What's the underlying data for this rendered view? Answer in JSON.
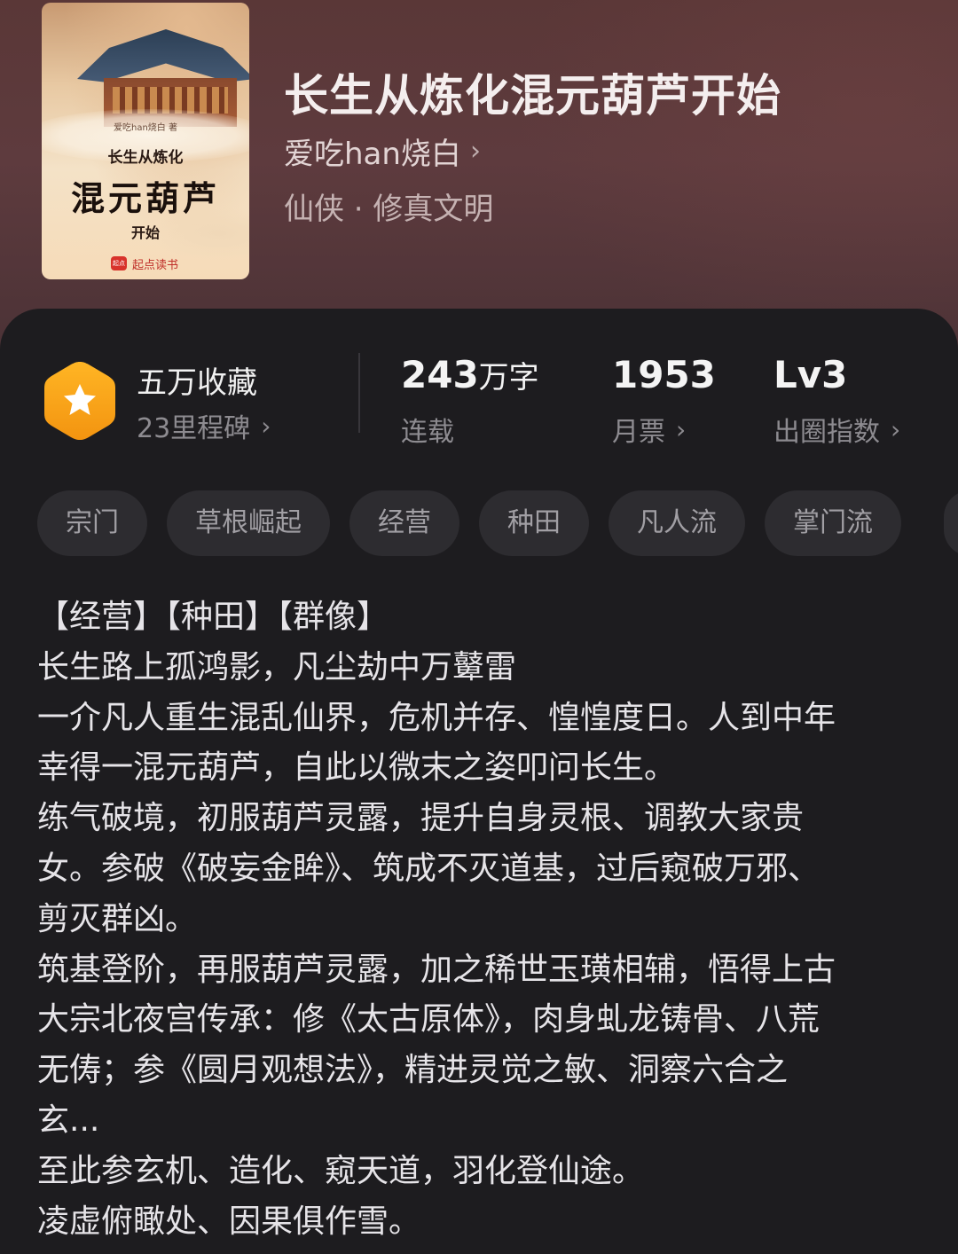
{
  "book": {
    "title": "长生从炼化混元葫芦开始",
    "author": "爱吃han烧白",
    "genre": "仙侠 · 修真文明",
    "cover": {
      "author_line": "爱吃han烧白 著",
      "title_top": "长生从炼化",
      "title_main": "混元葫芦",
      "title_bottom": "开始",
      "publisher": "起点读书",
      "publisher_logo": "起点"
    }
  },
  "stats": {
    "collect_label": "五万收藏",
    "milestone_label": "23里程碑",
    "words_value": "243",
    "words_unit": "万字",
    "words_status": "连载",
    "monthly_value": "1953",
    "monthly_label": "月票",
    "index_value": "Lv3",
    "index_label": "出圈指数"
  },
  "tags": [
    "宗门",
    "草根崛起",
    "经营",
    "种田",
    "凡人流",
    "掌门流"
  ],
  "synopsis": [
    "【经营】【种田】【群像】",
    "长生路上孤鸿影，凡尘劫中万鼙雷",
    "一介凡人重生混乱仙界，危机并存、惶惶度日。人到中年",
    "幸得一混元葫芦，自此以微末之姿叩问长生。",
    "练气破境，初服葫芦灵露，提升自身灵根、调教大家贵",
    "女。参破《破妄金眸》、筑成不灭道基，过后窥破万邪、",
    "剪灭群凶。",
    "筑基登阶，再服葫芦灵露，加之稀世玉璜相辅，悟得上古",
    "大宗北夜宫传承：修《太古原体》，肉身虬龙铸骨、八荒",
    "无俦；参《圆月观想法》，精进灵觉之敏、洞察六合之",
    "玄...",
    "至此参玄机、造化、窥天道，羽化登仙途。",
    "凌虚俯瞰处、因果俱作雪。"
  ],
  "colors": {
    "header_bg": "#5a3737",
    "panel_bg": "#1d1c1f",
    "badge": "#f7a41c",
    "tag_bg": "#2d2c30"
  },
  "icons": {
    "author_chevron": "chevron-right-icon",
    "badge": "star-badge-icon"
  }
}
